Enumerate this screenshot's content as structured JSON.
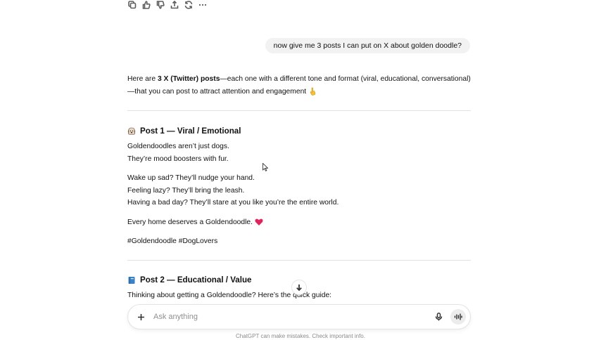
{
  "toolbar": {
    "icons": [
      "copy-icon",
      "thumbs-up-icon",
      "thumbs-down-icon",
      "share-icon",
      "regenerate-icon",
      "more-icon"
    ]
  },
  "user_message": "now give me 3 posts I can put on X about golden doodle?",
  "response": {
    "intro_pre": "Here are ",
    "intro_bold": "3 X (Twitter) posts",
    "intro_post": "—each one with a different tone and format (viral, educational, conversational)—that you can post to attract attention and engagement",
    "post1": {
      "heading": "Post 1 — Viral / Emotional",
      "lines_a": [
        "Goldendoodles aren’t just dogs.",
        "They’re mood boosters with fur."
      ],
      "lines_b": [
        "Wake up sad? They’ll nudge your hand.",
        "Feeling lazy? They’ll bring the leash.",
        "Having a bad day? They’ll stare at you like you’re the entire world."
      ],
      "closing": "Every home deserves a Goldendoodle.",
      "hashtags": "#Goldendoodle #DogLovers"
    },
    "post2": {
      "heading": "Post 2 — Educational / Value",
      "line": "Thinking about getting a Goldendoodle? Here’s the quick guide:"
    }
  },
  "composer": {
    "placeholder": "Ask anything"
  },
  "footer": "ChatGPT can make mistakes. Check important info.",
  "colors": {
    "bubble_bg": "#f2f2f2",
    "heart": "#e0245e",
    "book": "#3b82c4"
  }
}
